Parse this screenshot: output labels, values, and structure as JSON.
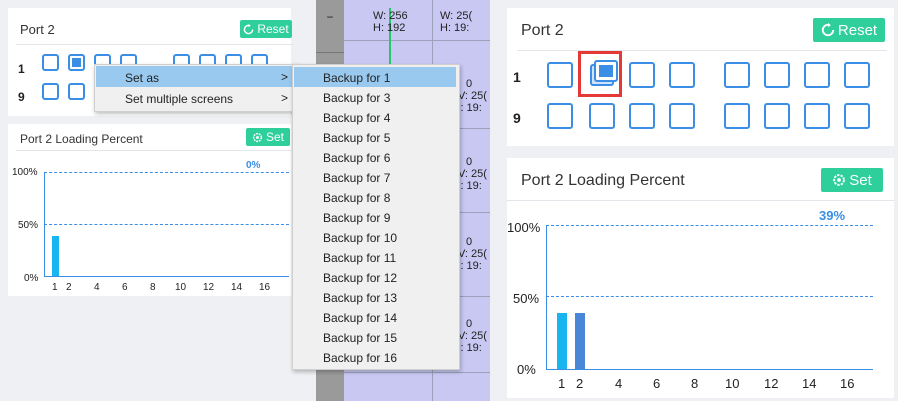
{
  "left": {
    "port_card": {
      "title": "Port 2",
      "reset_label": "Reset",
      "row1": "1",
      "row9": "9"
    },
    "loading_card": {
      "title": "Port 2 Loading Percent",
      "set_label": "Set",
      "percent": "0%",
      "y_ticks": [
        "100%",
        "50%",
        "0%"
      ],
      "x_ticks": [
        "1",
        "2",
        "4",
        "6",
        "8",
        "10",
        "12",
        "14",
        "16"
      ]
    },
    "context_menu": {
      "items": [
        "Set as",
        "Set multiple screens"
      ],
      "arrow": ">"
    },
    "submenu": {
      "items": [
        "Backup for 1",
        "Backup for 3",
        "Backup for 4",
        "Backup for 5",
        "Backup for 6",
        "Backup for 7",
        "Backup for 8",
        "Backup for 9",
        "Backup for 10",
        "Backup for 11",
        "Backup for 12",
        "Backup for 13",
        "Backup for 14",
        "Backup for 15",
        "Backup for 16"
      ]
    },
    "canvas_cells": {
      "minus": "−",
      "c1": {
        "w": "W: 256",
        "h": "H: 192"
      },
      "c2": {
        "w": "W: 25(",
        "h": "H: 19:"
      },
      "side": [
        {
          "n": "0",
          "w": "V: 25(",
          "h": "l: 19:"
        },
        {
          "n": "0",
          "w": "V: 25(",
          "h": "l: 19:"
        },
        {
          "n": "0",
          "w": "V: 25(",
          "h": "l: 19:"
        },
        {
          "n": "0",
          "w": "V: 25(",
          "h": "l: 19:"
        }
      ]
    }
  },
  "right": {
    "port_card": {
      "title": "Port 2",
      "reset_label": "Reset",
      "row1": "1",
      "row9": "9"
    },
    "loading_card": {
      "title": "Port 2 Loading Percent",
      "set_label": "Set",
      "percent": "39%",
      "y_ticks": [
        "100%",
        "50%",
        "0%"
      ],
      "x_ticks": [
        "1",
        "2",
        "4",
        "6",
        "8",
        "10",
        "12",
        "14",
        "16"
      ]
    }
  },
  "colors": {
    "accent": "#3a8ee6",
    "button_green": "#2ecf9a",
    "highlight_red": "#e53935",
    "bar_cyan": "#19b5f0",
    "bar_blue": "#4a86d8"
  }
}
